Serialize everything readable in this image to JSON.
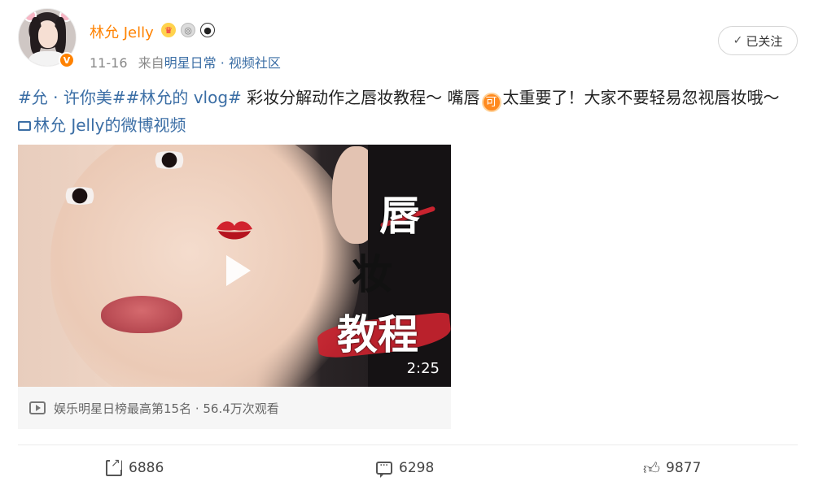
{
  "author": {
    "name": "林允 Jelly",
    "verified_mark": "V",
    "badges": [
      "crown-badge-icon",
      "medal-badge-icon",
      "panda-badge-icon"
    ]
  },
  "meta": {
    "date": "11-16",
    "source_prefix": "来自",
    "source": "明星日常 · 视频社区"
  },
  "follow": {
    "label": "已关注",
    "check": "✓"
  },
  "post": {
    "tag1": "#允 · 许你美#",
    "tag2": "#林允的 vlog#",
    "text1": " 彩妆分解动作之唇妆教程～ 嘴唇",
    "emoji": "可",
    "text2": "太重要了！大家不要轻易忽视唇妆哦～ ",
    "video_link": "林允 Jelly的微博视频"
  },
  "video": {
    "title_chars": [
      "唇",
      "妆",
      "教程"
    ],
    "duration": "2:25",
    "stats": "娱乐明星日榜最高第15名 · 56.4万次观看"
  },
  "actions": {
    "repost": "6886",
    "comment": "6298",
    "like": "9877"
  },
  "colors": {
    "accent": "#ff8200",
    "link": "#3b6ea5"
  }
}
